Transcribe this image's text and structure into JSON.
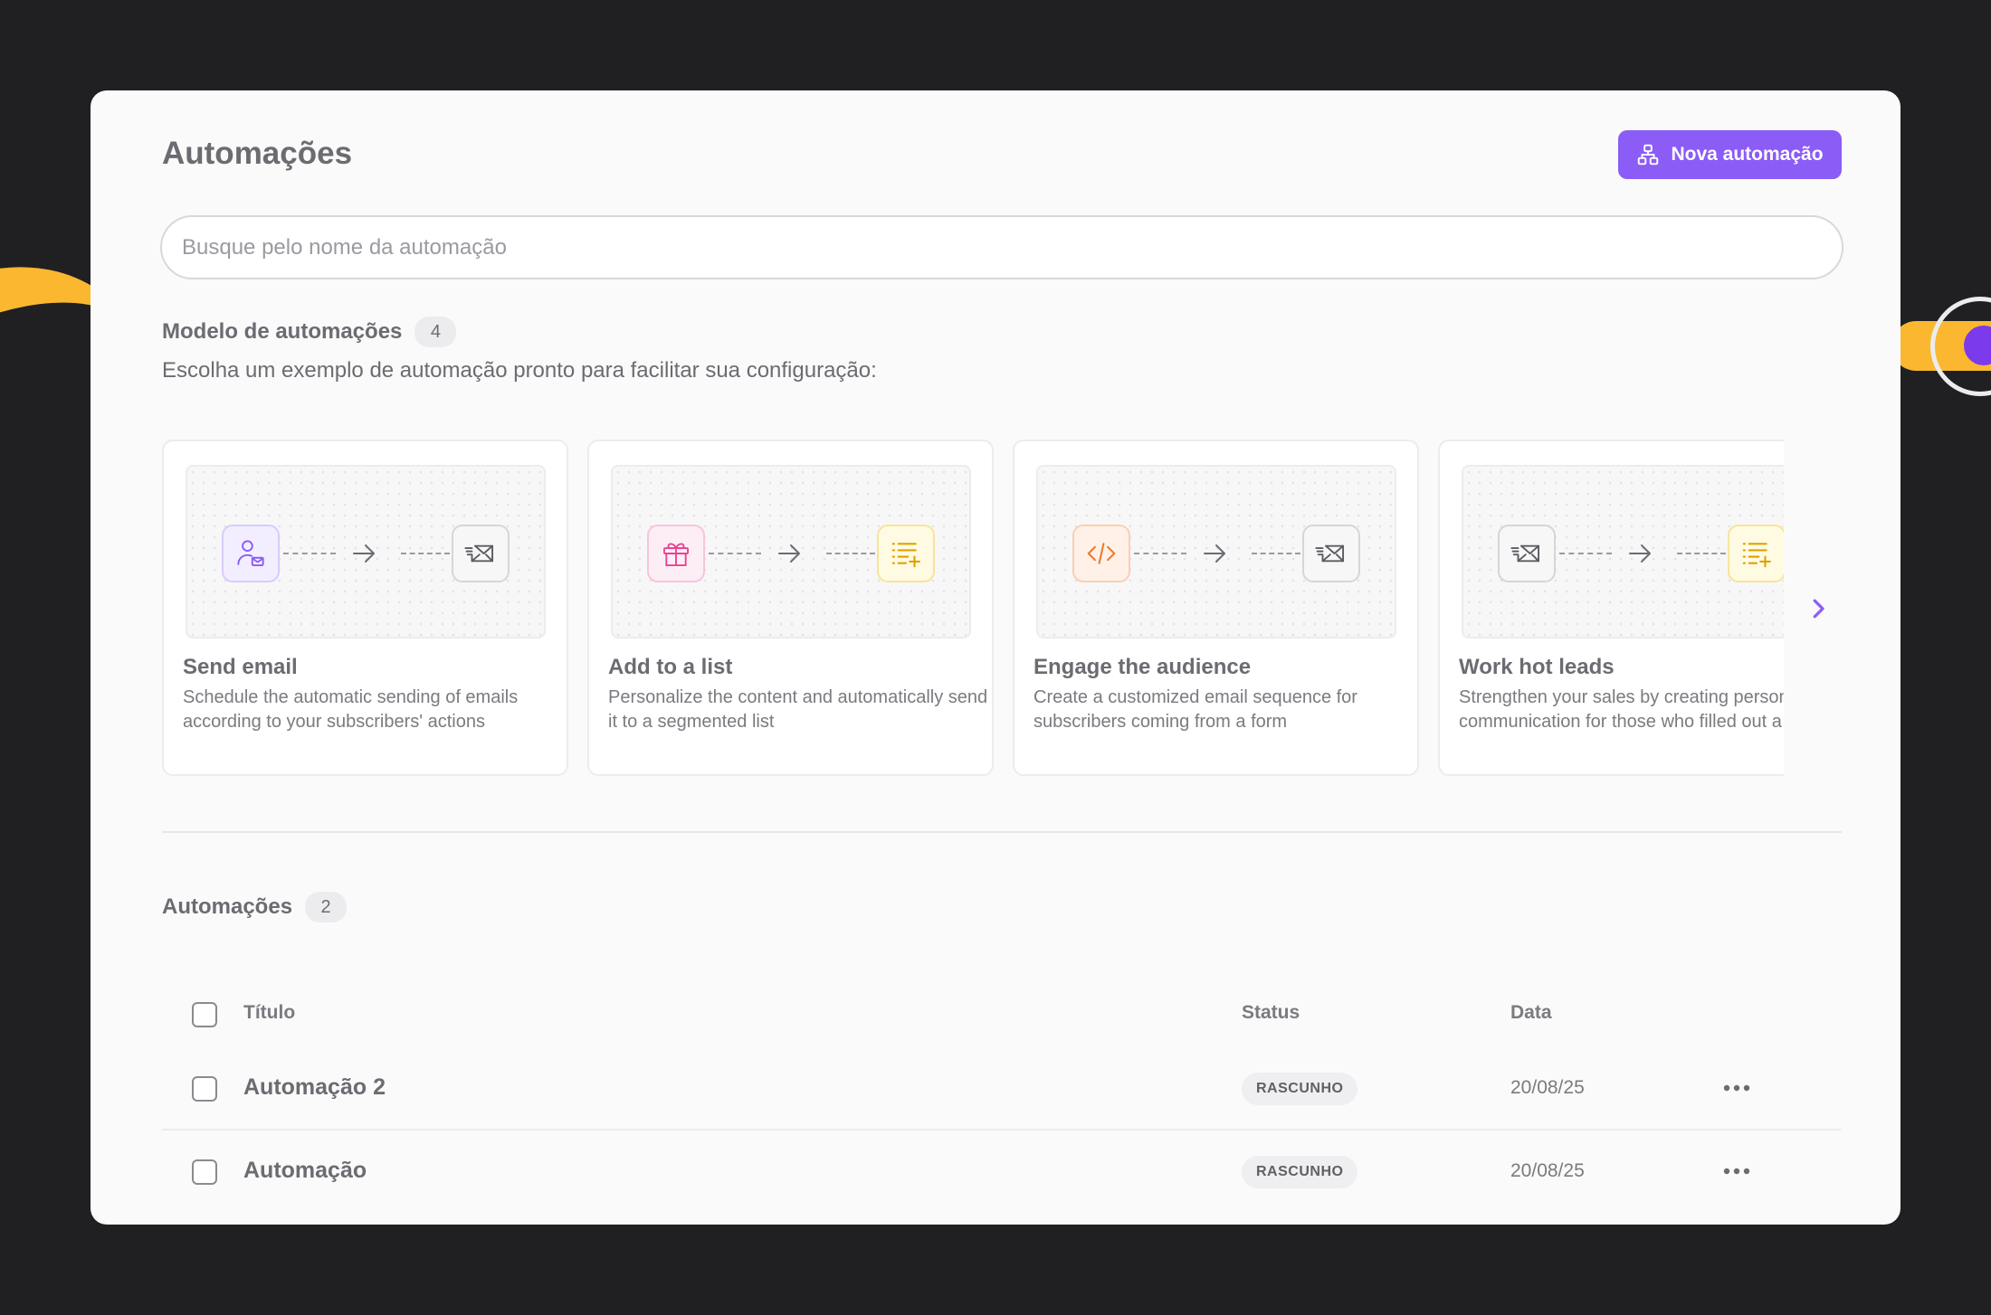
{
  "colors": {
    "background": "#202022",
    "window": "#fafafa",
    "accent": "#8b5cf6",
    "decoration_yellow": "#fcb731"
  },
  "header": {
    "title": "Automações",
    "new_button_label": "Nova automação",
    "new_button_icon": "workflow-icon"
  },
  "search": {
    "placeholder": "Busque pelo nome da automação",
    "value": ""
  },
  "templates": {
    "title": "Modelo de automações",
    "count": "4",
    "subtitle": "Escolha um exemplo de automação pronto para facilitar sua configuração:",
    "items": [
      {
        "title": "Send email",
        "description": "Schedule the automatic sending of emails according to your subscribers' actions",
        "from_icon": "user-mail-icon",
        "to_icon": "send-mail-icon"
      },
      {
        "title": "Add to a list",
        "description": "Personalize the content and automatically send it to a segmented list",
        "from_icon": "gift-icon",
        "to_icon": "list-add-icon"
      },
      {
        "title": "Engage the audience",
        "description": "Create a customized email sequence for subscribers coming from a form",
        "from_icon": "code-icon",
        "to_icon": "send-mail-icon"
      },
      {
        "title": "Work hot leads",
        "description": "Strengthen your sales by creating personalized communication for those who filled out a form",
        "from_icon": "send-mail-icon",
        "to_icon": "list-add-icon"
      }
    ]
  },
  "automations": {
    "title": "Automações",
    "count": "2",
    "columns": {
      "title": "Título",
      "status": "Status",
      "date": "Data"
    },
    "rows": [
      {
        "title": "Automação 2",
        "status": "RASCUNHO",
        "date": "20/08/25"
      },
      {
        "title": "Automação",
        "status": "RASCUNHO",
        "date": "20/08/25"
      }
    ]
  }
}
